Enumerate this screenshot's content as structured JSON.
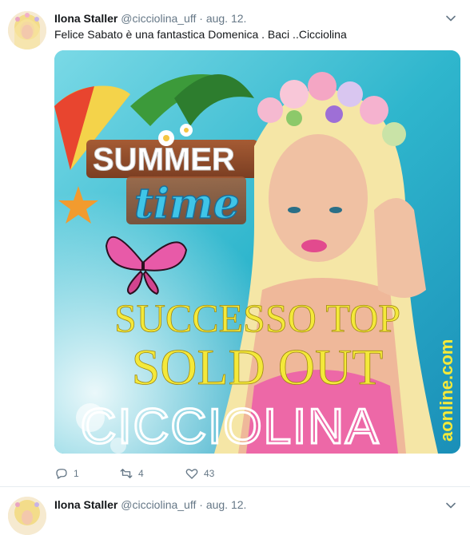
{
  "tweets": [
    {
      "author_name": "Ilona Staller",
      "handle": "@cicciolina_uff",
      "separator": "·",
      "date": "aug. 12.",
      "text": "Felice Sabato è una fantastica Domenica . Baci ..Cicciolina",
      "media": {
        "sign_top": "SUMMER",
        "sign_script": "time",
        "headline_1": "SUCCESSO TOP",
        "headline_2": "SOLD OUT",
        "brand": "CICCIOLINA",
        "side_text": "aonline.com"
      },
      "actions": {
        "replies": "1",
        "retweets": "4",
        "likes": "43"
      }
    },
    {
      "author_name": "Ilona Staller",
      "handle": "@cicciolina_uff",
      "separator": "·",
      "date": "aug. 12."
    }
  ],
  "colors": {
    "link_gray": "#657786",
    "text": "#14171a",
    "divider": "#e6ecf0",
    "sky": "#49c7d6",
    "headline_yellow": "#f4e93a"
  }
}
